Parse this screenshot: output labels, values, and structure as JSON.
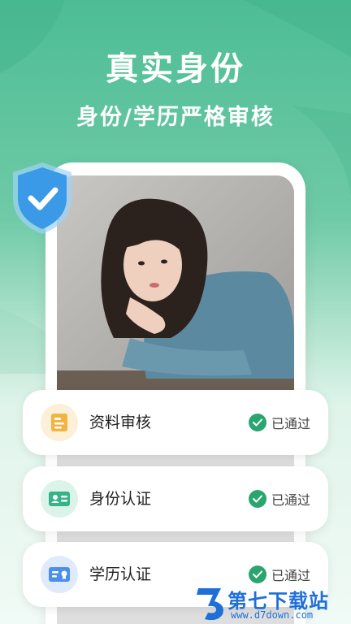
{
  "headline": "真实身份",
  "subheadline": "身份/学历严格审核",
  "colors": {
    "background_top": "#4dbd95",
    "accent_green": "#2aa56f",
    "shield_blue": "#3a9ae8",
    "watermark_blue": "#1f6fd8"
  },
  "photo": {
    "description_icon": "portrait-photo"
  },
  "verification_items": [
    {
      "label": "资料审核",
      "status": "已通过",
      "icon": "document-icon"
    },
    {
      "label": "身份认证",
      "status": "已通过",
      "icon": "id-card-icon"
    },
    {
      "label": "学历认证",
      "status": "已通过",
      "icon": "certificate-icon"
    }
  ],
  "watermark": {
    "title": "第七下载站",
    "url": "www.d7down.com"
  }
}
